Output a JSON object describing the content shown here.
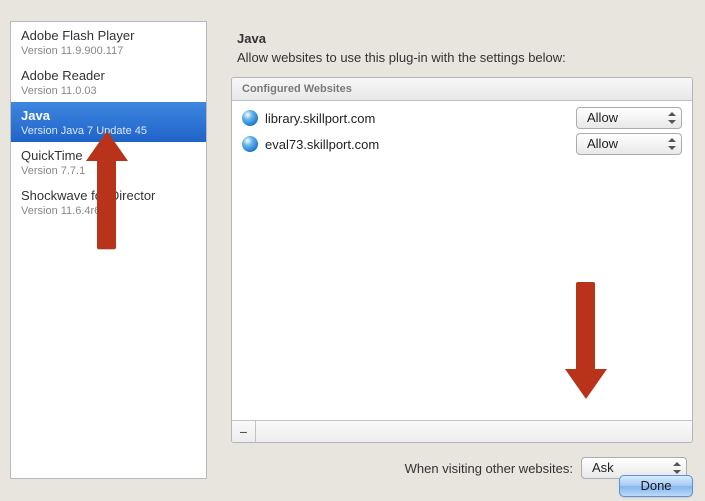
{
  "sidebar": {
    "items": [
      {
        "title": "Adobe Flash Player",
        "version": "Version 11.9.900.117",
        "selected": false
      },
      {
        "title": "Adobe Reader",
        "version": "Version 11.0.03",
        "selected": false
      },
      {
        "title": "Java",
        "version": "Version Java 7 Update 45",
        "selected": true
      },
      {
        "title": "QuickTime",
        "version": "Version 7.7.1",
        "selected": false
      },
      {
        "title": "Shockwave for Director",
        "version": "Version 11.6.4r634",
        "selected": false
      }
    ]
  },
  "main": {
    "section_title": "Java",
    "section_desc": "Allow websites to use this plug-in with the settings below:",
    "table_header": "Configured Websites",
    "remove_glyph": "−"
  },
  "websites": [
    {
      "name": "library.skillport.com",
      "mode": "Allow"
    },
    {
      "name": "eval73.skillport.com",
      "mode": "Allow"
    }
  ],
  "other_websites": {
    "label": "When visiting other websites:",
    "value": "Ask"
  },
  "buttons": {
    "done": "Done"
  }
}
